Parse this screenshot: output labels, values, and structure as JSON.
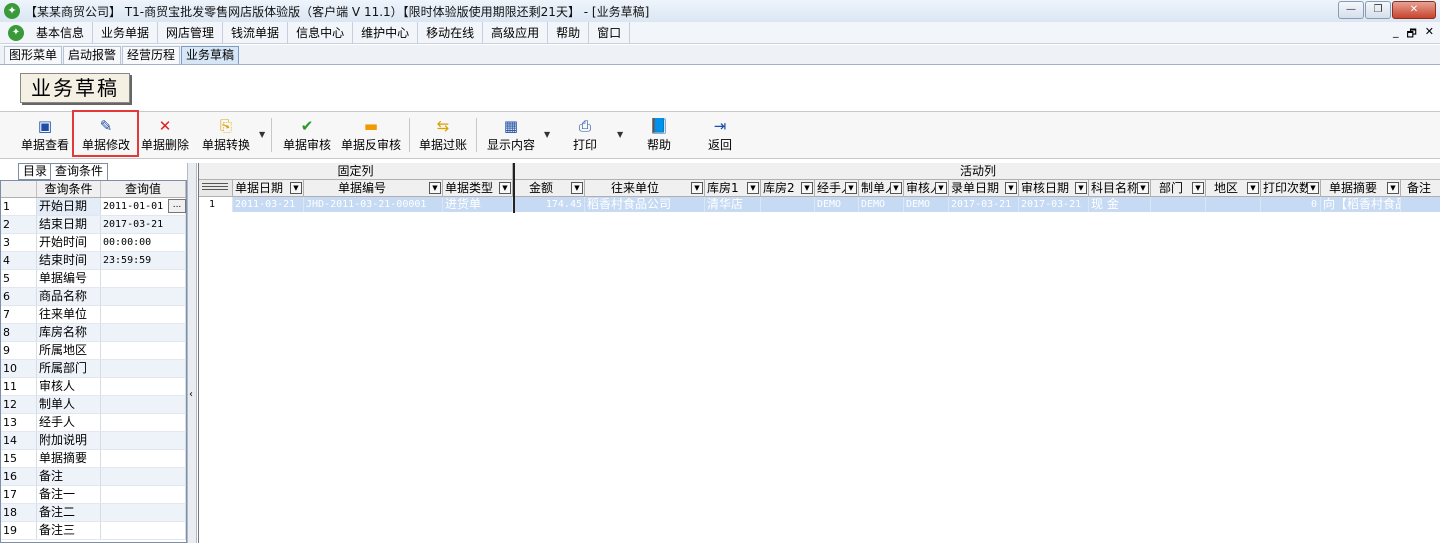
{
  "window": {
    "title": "【某某商贸公司】 T1-商贸宝批发零售网店版体验版（客户端 V 11.1）【限时体验版使用期限还剩21天】 - [业务草稿]",
    "min_label": "—",
    "max_label": "❐",
    "close_label": "✕"
  },
  "menu": {
    "items": [
      "基本信息",
      "业务单据",
      "网店管理",
      "钱流单据",
      "信息中心",
      "维护中心",
      "移动在线",
      "高级应用",
      "帮助",
      "窗口"
    ],
    "mdi_min": "_",
    "mdi_restore": "🗗",
    "mdi_close": "✕"
  },
  "module_tabs": [
    "图形菜单",
    "启动报警",
    "经营历程",
    "业务草稿"
  ],
  "page_heading": "业务草稿",
  "toolbar": {
    "view": "单据查看",
    "edit": "单据修改",
    "delete": "单据删除",
    "convert": "单据转换",
    "audit": "单据审核",
    "unaudit": "单据反审核",
    "post": "单据过账",
    "display": "显示内容",
    "print": "打印",
    "help": "帮助",
    "back": "返回"
  },
  "left_tabs": {
    "dir": "目录",
    "query": "查询条件"
  },
  "query": {
    "header_name": "查询条件",
    "header_value": "查询值",
    "rows": [
      {
        "n": "1",
        "name": "开始日期",
        "value": "2011-01-01"
      },
      {
        "n": "2",
        "name": "结束日期",
        "value": "2017-03-21"
      },
      {
        "n": "3",
        "name": "开始时间",
        "value": "00:00:00"
      },
      {
        "n": "4",
        "name": "结束时间",
        "value": "23:59:59"
      },
      {
        "n": "5",
        "name": "单据编号",
        "value": ""
      },
      {
        "n": "6",
        "name": "商品名称",
        "value": ""
      },
      {
        "n": "7",
        "name": "往来单位",
        "value": ""
      },
      {
        "n": "8",
        "name": "库房名称",
        "value": ""
      },
      {
        "n": "9",
        "name": "所属地区",
        "value": ""
      },
      {
        "n": "10",
        "name": "所属部门",
        "value": ""
      },
      {
        "n": "11",
        "name": "审核人",
        "value": ""
      },
      {
        "n": "12",
        "name": "制单人",
        "value": ""
      },
      {
        "n": "13",
        "name": "经手人",
        "value": ""
      },
      {
        "n": "14",
        "name": "附加说明",
        "value": ""
      },
      {
        "n": "15",
        "name": "单据摘要",
        "value": ""
      },
      {
        "n": "16",
        "name": "备注",
        "value": ""
      },
      {
        "n": "17",
        "name": "备注一",
        "value": ""
      },
      {
        "n": "18",
        "name": "备注二",
        "value": ""
      },
      {
        "n": "19",
        "name": "备注三",
        "value": ""
      }
    ],
    "ellipsis": "..."
  },
  "grid": {
    "group_fixed": "固定列",
    "group_active": "活动列",
    "columns": {
      "date": "单据日期",
      "code": "单据编号",
      "type": "单据类型",
      "amount": "金额",
      "partner": "往来单位",
      "wh1": "库房1",
      "wh2": "库房2",
      "handler": "经手人",
      "maker": "制单人",
      "auditor": "审核人",
      "entry_date": "录单日期",
      "audit_date": "审核日期",
      "account": "科目名称",
      "dept": "部门",
      "region": "地区",
      "print_count": "打印次数",
      "summary": "单据摘要",
      "remark": "备注"
    },
    "row": {
      "n": "1",
      "date": "2011-03-21",
      "code": "JHD-2011-03-21-00001",
      "type": "进货单",
      "amount": "174.45",
      "partner": "稻香村食品公司",
      "wh1": "清华店",
      "wh2": "",
      "handler": "DEMO",
      "maker": "DEMO",
      "auditor": "DEMO",
      "entry_date": "2017-03-21",
      "audit_date": "2017-03-21",
      "account": "现 金",
      "dept": "",
      "region": "",
      "print_count": "0",
      "summary": "向【稻香村食品公司】",
      "remark": ""
    }
  },
  "colors": {
    "highlight": "#e23a3a",
    "row_selected": "#c6daf4",
    "active_tab": "#d7e6f7"
  }
}
